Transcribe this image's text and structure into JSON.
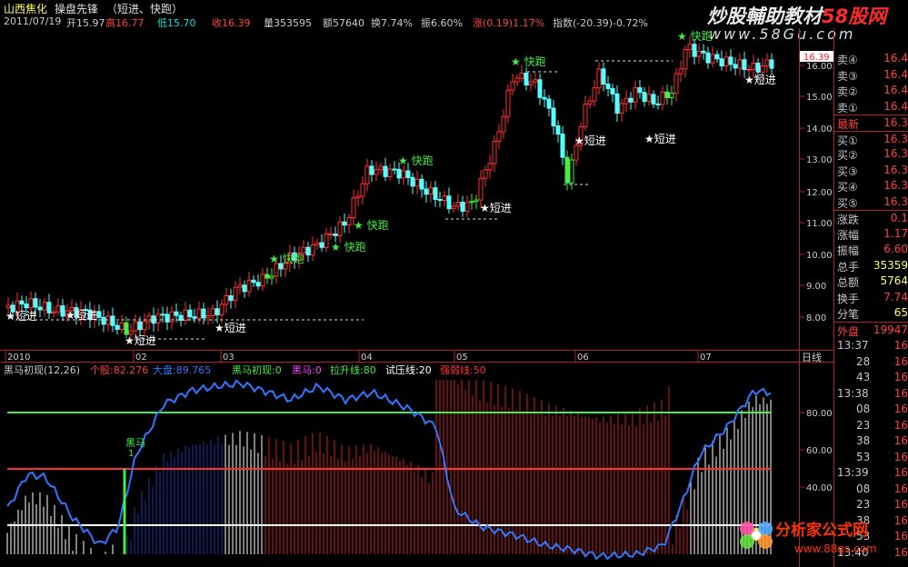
{
  "header": {
    "stock_name": "山西焦化",
    "formula_name": "操盘先锋",
    "formula_params": "（短进、快跑）"
  },
  "watermark": {
    "text_white": "炒股輔助教材",
    "text_red": "58股网",
    "url": "www.58Gu.com"
  },
  "info": {
    "date": "2011/07/19",
    "open_label": "开15.97",
    "high_label": "高16.77",
    "low_label": "低15.70",
    "close_label": "收16.39",
    "volume_label": "量353595",
    "amount_label": "额57640",
    "turnover_label": "换7.74%",
    "amplitude_label": "振6.60%",
    "change_label": "涨(0.19)1.17%",
    "index_label": "指数(-20.39)-0.72%"
  },
  "main_chart": {
    "price_ticks": [
      "16.00",
      "15.00",
      "14.00",
      "13.00",
      "12.00",
      "11.00",
      "10.00",
      "9.00",
      "8.00"
    ],
    "price_box": "16.39",
    "date_ticks": [
      "2010",
      "02",
      "03",
      "04",
      "05",
      "06",
      "07"
    ],
    "period_label": "日线",
    "signals": [
      {
        "text": "★短进",
        "kind": "buy"
      },
      {
        "text": "★短进",
        "kind": "buy"
      },
      {
        "text": "★短进",
        "kind": "buy"
      },
      {
        "text": "★短进",
        "kind": "buy"
      },
      {
        "text": "★短进",
        "kind": "buy"
      },
      {
        "text": "★短进",
        "kind": "buy"
      },
      {
        "text": "★短进",
        "kind": "buy"
      },
      {
        "text": "★短进",
        "kind": "buy"
      },
      {
        "text": "★ 快跑",
        "kind": "sell"
      },
      {
        "text": "★ 快跑",
        "kind": "sell"
      },
      {
        "text": "★ 快跑",
        "kind": "sell"
      },
      {
        "text": "★ 快跑",
        "kind": "sell"
      },
      {
        "text": "★ 快跑",
        "kind": "sell"
      },
      {
        "text": "★ 快跑",
        "kind": "sell"
      }
    ]
  },
  "indicator": {
    "name": "黑马初现(12,26)",
    "stock_val": "个股:82.276",
    "market_val": "大盘:89.765",
    "dark_horse_init": "黑马初现:0",
    "dark_horse": "黑马:0",
    "lift_line": "拉升线:80",
    "test_line": "试压线:20",
    "strong_line": "强弱线:50",
    "ticks": [
      "80.00",
      "60.00",
      "40.00"
    ],
    "marker_label": "黑马",
    "marker_value": "1"
  },
  "quote_panel": {
    "sell": [
      {
        "label": "卖④",
        "value": "16.4"
      },
      {
        "label": "卖③",
        "value": "16.4"
      },
      {
        "label": "卖②",
        "value": "16.4"
      },
      {
        "label": "卖①",
        "value": "16.4"
      }
    ],
    "latest_label": "最新",
    "latest_value": "16.3",
    "buy": [
      {
        "label": "买①",
        "value": "16.3"
      },
      {
        "label": "买②",
        "value": "16.3"
      },
      {
        "label": "买③",
        "value": "16.3"
      },
      {
        "label": "买④",
        "value": "16.3"
      },
      {
        "label": "买⑤",
        "value": "16.3"
      }
    ],
    "stats": [
      {
        "label": "涨跌",
        "value": "0.1"
      },
      {
        "label": "涨幅",
        "value": "1.17"
      },
      {
        "label": "振幅",
        "value": "6.60"
      },
      {
        "label": "总手",
        "value": "35359"
      },
      {
        "label": "总额",
        "value": "5764"
      },
      {
        "label": "换手",
        "value": "7.74"
      },
      {
        "label": "分笔",
        "value": "65"
      }
    ],
    "outer_label": "外盘",
    "outer_value": "19947",
    "ticks": [
      {
        "time": "13:37",
        "value": "16"
      },
      {
        "time": "28",
        "value": "16"
      },
      {
        "time": "43",
        "value": "16"
      },
      {
        "time": "13:38",
        "value": "16"
      },
      {
        "time": "08",
        "value": "16"
      },
      {
        "time": "23",
        "value": "16"
      },
      {
        "time": "38",
        "value": "16"
      },
      {
        "time": "53",
        "value": "16"
      },
      {
        "time": "13:39",
        "value": "16"
      },
      {
        "time": "08",
        "value": "16"
      },
      {
        "time": "23",
        "value": "16"
      },
      {
        "time": "38",
        "value": "16"
      },
      {
        "time": "53",
        "value": "16"
      },
      {
        "time": "13:40",
        "value": "16"
      }
    ]
  },
  "bottom_logo": {
    "title": "分析家公式网",
    "url": "www.88gs.com"
  },
  "colors": {
    "up": "#ff3030",
    "down": "#00ffff",
    "green": "#44ee44",
    "blue": "#3366ff",
    "white": "#ffffff",
    "frame": "#b02020",
    "yellow": "#ffff55"
  }
}
